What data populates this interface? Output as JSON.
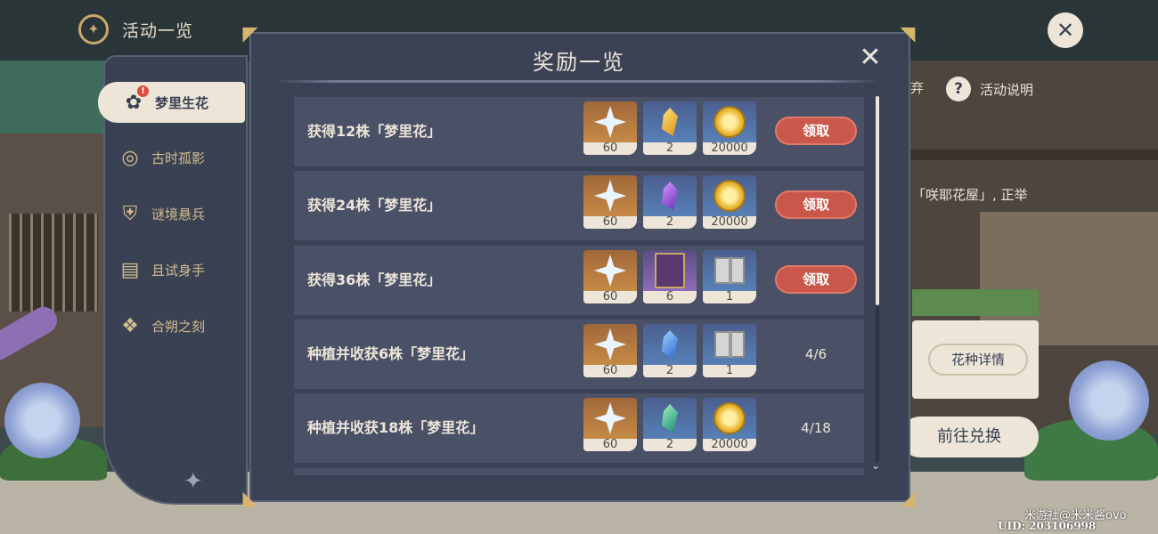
{
  "topbar": {
    "title": "活动一览"
  },
  "sidebar": {
    "items": [
      {
        "label": "梦里生花",
        "badge": "!"
      },
      {
        "label": "古时孤影"
      },
      {
        "label": "谜境悬兵"
      },
      {
        "label": "且试身手"
      },
      {
        "label": "合朔之刻"
      }
    ]
  },
  "behind": {
    "partial_text": "弃",
    "help_label": "活动说明",
    "description": "「咲耶花屋」, 正举",
    "detail_button": "花种详情",
    "exchange_button": "前往兑换"
  },
  "modal": {
    "title": "奖励一览",
    "rows": [
      {
        "label": "获得12株「梦里花」",
        "rewards": [
          {
            "icon": "primogem",
            "qty": "60"
          },
          {
            "icon": "gold-gem",
            "qty": "2"
          },
          {
            "icon": "mora",
            "qty": "20000"
          }
        ],
        "action": "领取"
      },
      {
        "label": "获得24株「梦里花」",
        "rewards": [
          {
            "icon": "primogem",
            "qty": "60"
          },
          {
            "icon": "violet-gem",
            "qty": "2"
          },
          {
            "icon": "mora",
            "qty": "20000"
          }
        ],
        "action": "领取"
      },
      {
        "label": "获得36株「梦里花」",
        "rewards": [
          {
            "icon": "primogem",
            "qty": "60"
          },
          {
            "icon": "book",
            "qty": "6"
          },
          {
            "icon": "gift-box",
            "qty": "1"
          }
        ],
        "action": "领取"
      },
      {
        "label": "种植并收获6株「梦里花」",
        "rewards": [
          {
            "icon": "primogem",
            "qty": "60"
          },
          {
            "icon": "blue-gem",
            "qty": "2"
          },
          {
            "icon": "gift-box",
            "qty": "1"
          }
        ],
        "progress": "4/6"
      },
      {
        "label": "种植并收获18株「梦里花」",
        "rewards": [
          {
            "icon": "primogem",
            "qty": "60"
          },
          {
            "icon": "green-gem",
            "qty": "2"
          },
          {
            "icon": "mora",
            "qty": "20000"
          }
        ],
        "progress": "4/18"
      }
    ]
  },
  "watermark": {
    "text": "米游社@米米酱ovo",
    "uid": "UID: 203106998"
  }
}
